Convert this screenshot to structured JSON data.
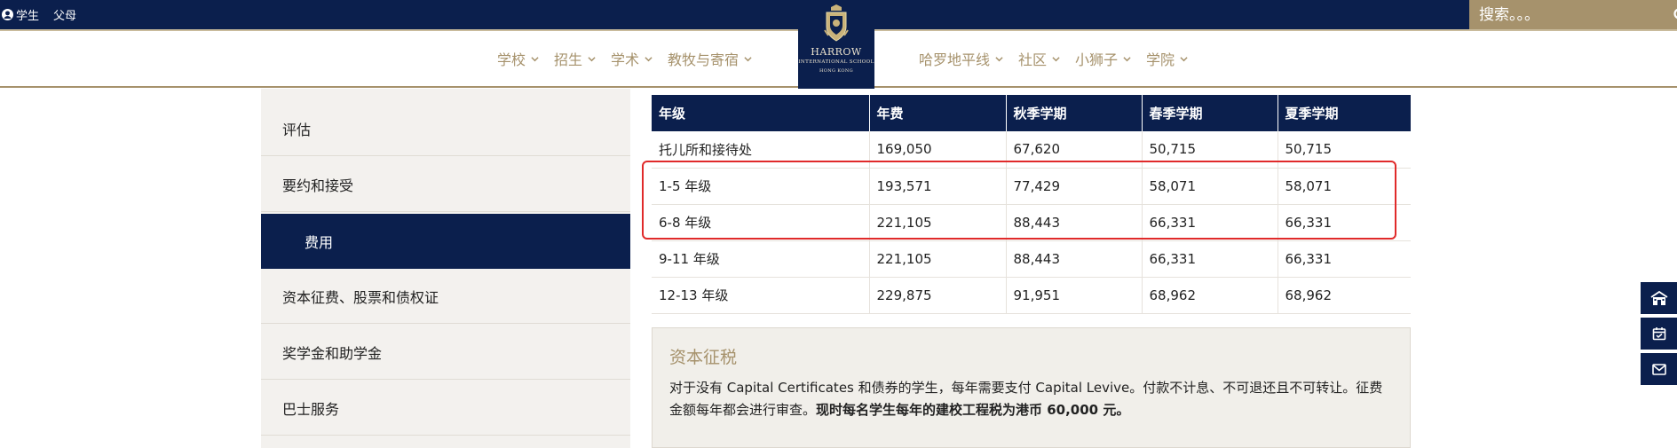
{
  "topbar": {
    "links": [
      {
        "label": "学生",
        "icon": "user-circle-icon"
      },
      {
        "label": "父母"
      }
    ],
    "search": {
      "placeholder": "搜索。。。",
      "icon": "search-icon"
    }
  },
  "nav": {
    "left": [
      {
        "label": "学校"
      },
      {
        "label": "招生"
      },
      {
        "label": "学术"
      },
      {
        "label": "教牧与寄宿"
      }
    ],
    "right": [
      {
        "label": "哈罗地平线"
      },
      {
        "label": "社区"
      },
      {
        "label": "小狮子"
      },
      {
        "label": "学院"
      }
    ],
    "logo": {
      "line1": "HARROW",
      "line2": "INTERNATIONAL SCHOOL",
      "line3": "HONG KONG"
    }
  },
  "sidebar": {
    "items": [
      {
        "label": "评估"
      },
      {
        "label": "要约和接受"
      },
      {
        "label": "费用",
        "active": true
      },
      {
        "label": "资本征费、股票和债权证"
      },
      {
        "label": "奖学金和助学金"
      },
      {
        "label": "巴士服务"
      }
    ]
  },
  "table": {
    "headers": [
      "年级",
      "年费",
      "秋季学期",
      "春季学期",
      "夏季学期"
    ],
    "rows": [
      [
        "托儿所和接待处",
        "169,050",
        "67,620",
        "50,715",
        "50,715"
      ],
      [
        "1-5 年级",
        "193,571",
        "77,429",
        "58,071",
        "58,071"
      ],
      [
        "6-8 年级",
        "221,105",
        "88,443",
        "66,331",
        "66,331"
      ],
      [
        "9-11 年级",
        "221,105",
        "88,443",
        "66,331",
        "66,331"
      ],
      [
        "12-13 年级",
        "229,875",
        "91,951",
        "68,962",
        "68,962"
      ]
    ]
  },
  "levy": {
    "title": "资本征税",
    "text": "对于没有 Capital Certificates 和债券的学生，每年需要支付 Capital Levive。付款不计息、不可退还且不可转让。征费金额每年都会进行审查。",
    "bold": "现时每名学生每年的建校工程税为港币 60,000 元。"
  },
  "float_buttons": [
    "school-building-icon",
    "calendar-check-icon",
    "mail-icon"
  ],
  "colors": {
    "navy": "#0b1f4d",
    "gold": "#a6926c",
    "highlight": "#e02a2a"
  }
}
